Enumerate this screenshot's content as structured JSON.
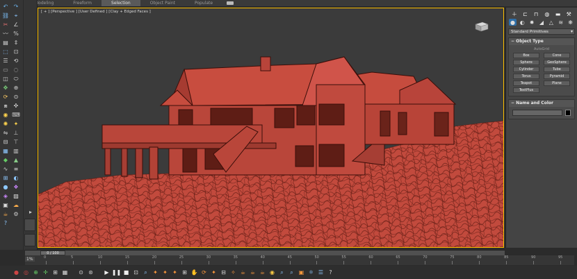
{
  "ribbon": {
    "tabs": [
      {
        "label": "Modeling",
        "active": false
      },
      {
        "label": "Freeform",
        "active": false
      },
      {
        "label": "Selection",
        "active": true
      },
      {
        "label": "Object Paint",
        "active": false
      },
      {
        "label": "Populate",
        "active": false
      }
    ]
  },
  "viewport": {
    "label": "[ + ] [Perspective ] [User Defined ] [Clay + Edged Faces ]",
    "accent": "#ffc000",
    "model_color": "#c0493b",
    "icons": [
      "viewcube-icon"
    ]
  },
  "command_panel": {
    "category_dropdown": "Standard Primitives",
    "object_type": {
      "title": "Object Type",
      "autogrid": "AutoGrid",
      "buttons": [
        "Box",
        "Cone",
        "Sphere",
        "GeoSphere",
        "Cylinder",
        "Tube",
        "Torus",
        "Pyramid",
        "Teapot",
        "Plane",
        "TextPlus"
      ]
    },
    "name_and_color": {
      "title": "Name and Color",
      "name_value": "",
      "color": "#000000"
    }
  },
  "timeline": {
    "frame_slider": "0 / 100",
    "percent_label": "1%",
    "ruler_marks": [
      "0",
      "5",
      "10",
      "15",
      "20",
      "25",
      "30",
      "35",
      "40",
      "45",
      "50",
      "55",
      "60",
      "65",
      "70",
      "75",
      "80",
      "85",
      "90",
      "95"
    ]
  }
}
